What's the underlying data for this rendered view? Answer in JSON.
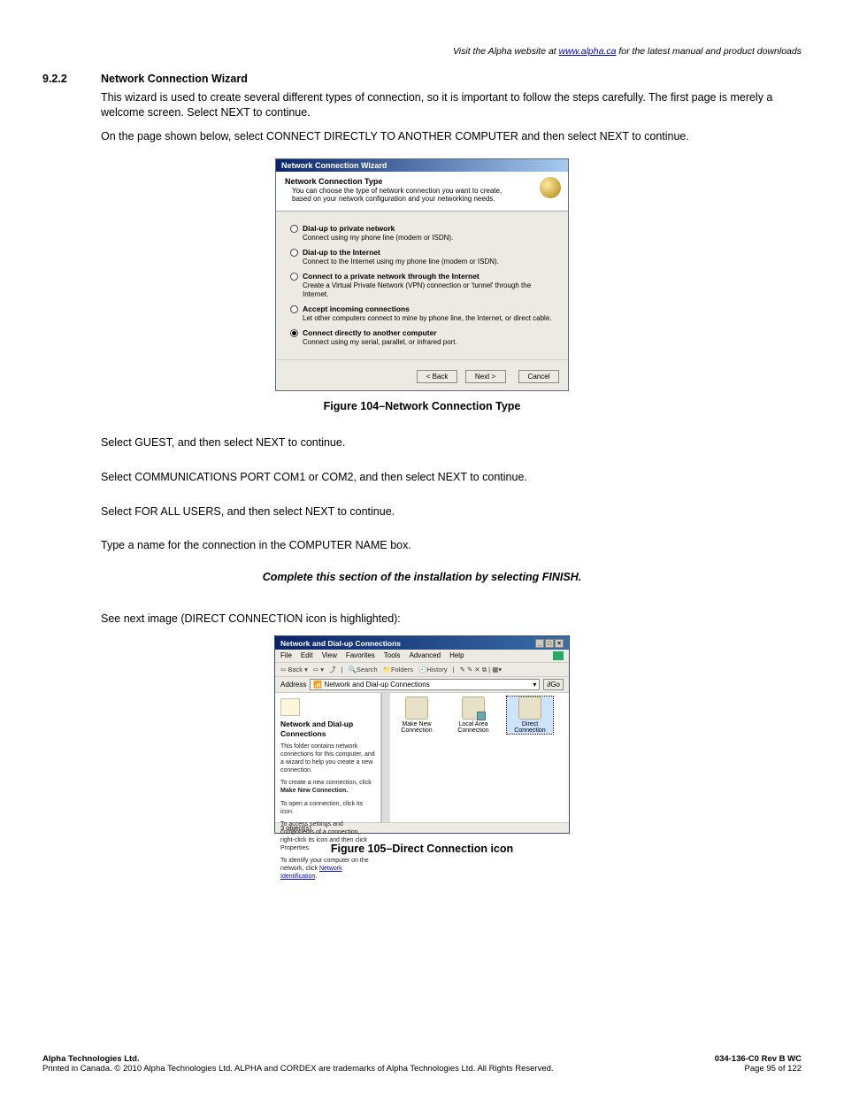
{
  "top_note_prefix": "Visit the Alpha website at ",
  "top_note_link_text": "www.alpha.ca",
  "top_note_suffix": " for the latest manual and product downloads",
  "section_num": "9.2.2",
  "section_title": "Network Connection Wizard",
  "para1": "This wizard is used to create several different types of connection, so it is important to follow the steps carefully. The first page is merely a welcome screen. Select NEXT to continue.",
  "para2": "On the page shown below, select CONNECT DIRECTLY TO ANOTHER COMPUTER and then select NEXT to continue.",
  "wizard": {
    "title": "Network Connection Wizard",
    "head_title": "Network Connection Type",
    "head_sub": "You can choose the type of network connection you want to create, based on your network configuration and your networking needs.",
    "options": [
      {
        "label": "Dial-up to private network",
        "desc": "Connect using my phone line (modem or ISDN).",
        "selected": false
      },
      {
        "label": "Dial-up to the Internet",
        "desc": "Connect to the Internet using my phone line (modem or ISDN).",
        "selected": false
      },
      {
        "label": "Connect to a private network through the Internet",
        "desc": "Create a Virtual Private Network (VPN) connection or 'tunnel' through the Internet.",
        "selected": false
      },
      {
        "label": "Accept incoming connections",
        "desc": "Let other computers connect to mine by phone line, the Internet, or direct cable.",
        "selected": false
      },
      {
        "label": "Connect directly to another computer",
        "desc": "Connect using my serial, parallel, or infrared port.",
        "selected": true
      }
    ],
    "btn_back": "< Back",
    "btn_next": "Next >",
    "btn_cancel": "Cancel"
  },
  "fig104": "Figure 104–Network Connection Type",
  "para3": "Select GUEST, and then select NEXT to continue.",
  "para4": "Select COMMUNICATIONS PORT COM1 or COM2, and then select NEXT to continue.",
  "para5": "Select FOR ALL USERS, and then select NEXT to continue.",
  "para6": "Type a name for the connection in the COMPUTER NAME box.",
  "finish_line": "Complete this section of the installation by selecting FINISH.",
  "para7": "See next image (DIRECT CONNECTION icon is highlighted):",
  "explorer": {
    "title": "Network and Dial-up Connections",
    "menu": [
      "File",
      "Edit",
      "View",
      "Favorites",
      "Tools",
      "Advanced",
      "Help"
    ],
    "toolbar_back": "Back",
    "toolbar_search": "Search",
    "toolbar_folders": "Folders",
    "toolbar_history": "History",
    "addr_label": "Address",
    "addr_value": "Network and Dial-up Connections",
    "go_label": "Go",
    "left_title": "Network and Dial-up Connections",
    "left_p1": "This folder contains network connections for this computer, and a wizard to help you create a new connection.",
    "left_p2a": "To create a new connection, click ",
    "left_p2b": "Make New Connection.",
    "left_p3": "To open a connection, click its icon.",
    "left_p4": "To access settings and components of a connection, right-click its icon and then click Properties.",
    "left_p5a": "To identify your computer on the network, click ",
    "left_p5b": "Network Identification",
    "items": [
      {
        "label": "Make New Connection",
        "selected": false
      },
      {
        "label": "Local Area Connection",
        "selected": false
      },
      {
        "label": "Direct Connection",
        "selected": true
      }
    ],
    "status": "3 object(s)"
  },
  "fig105": "Figure 105–Direct Connection icon",
  "footer": {
    "left1": "Alpha Technologies Ltd.",
    "left2": "Printed in Canada.  © 2010 Alpha Technologies Ltd.  ALPHA and CORDEX are trademarks of Alpha Technologies Ltd.  All Rights Reserved.",
    "right1": "034-136-C0  Rev B  WC",
    "right2": "Page 95 of 122"
  }
}
